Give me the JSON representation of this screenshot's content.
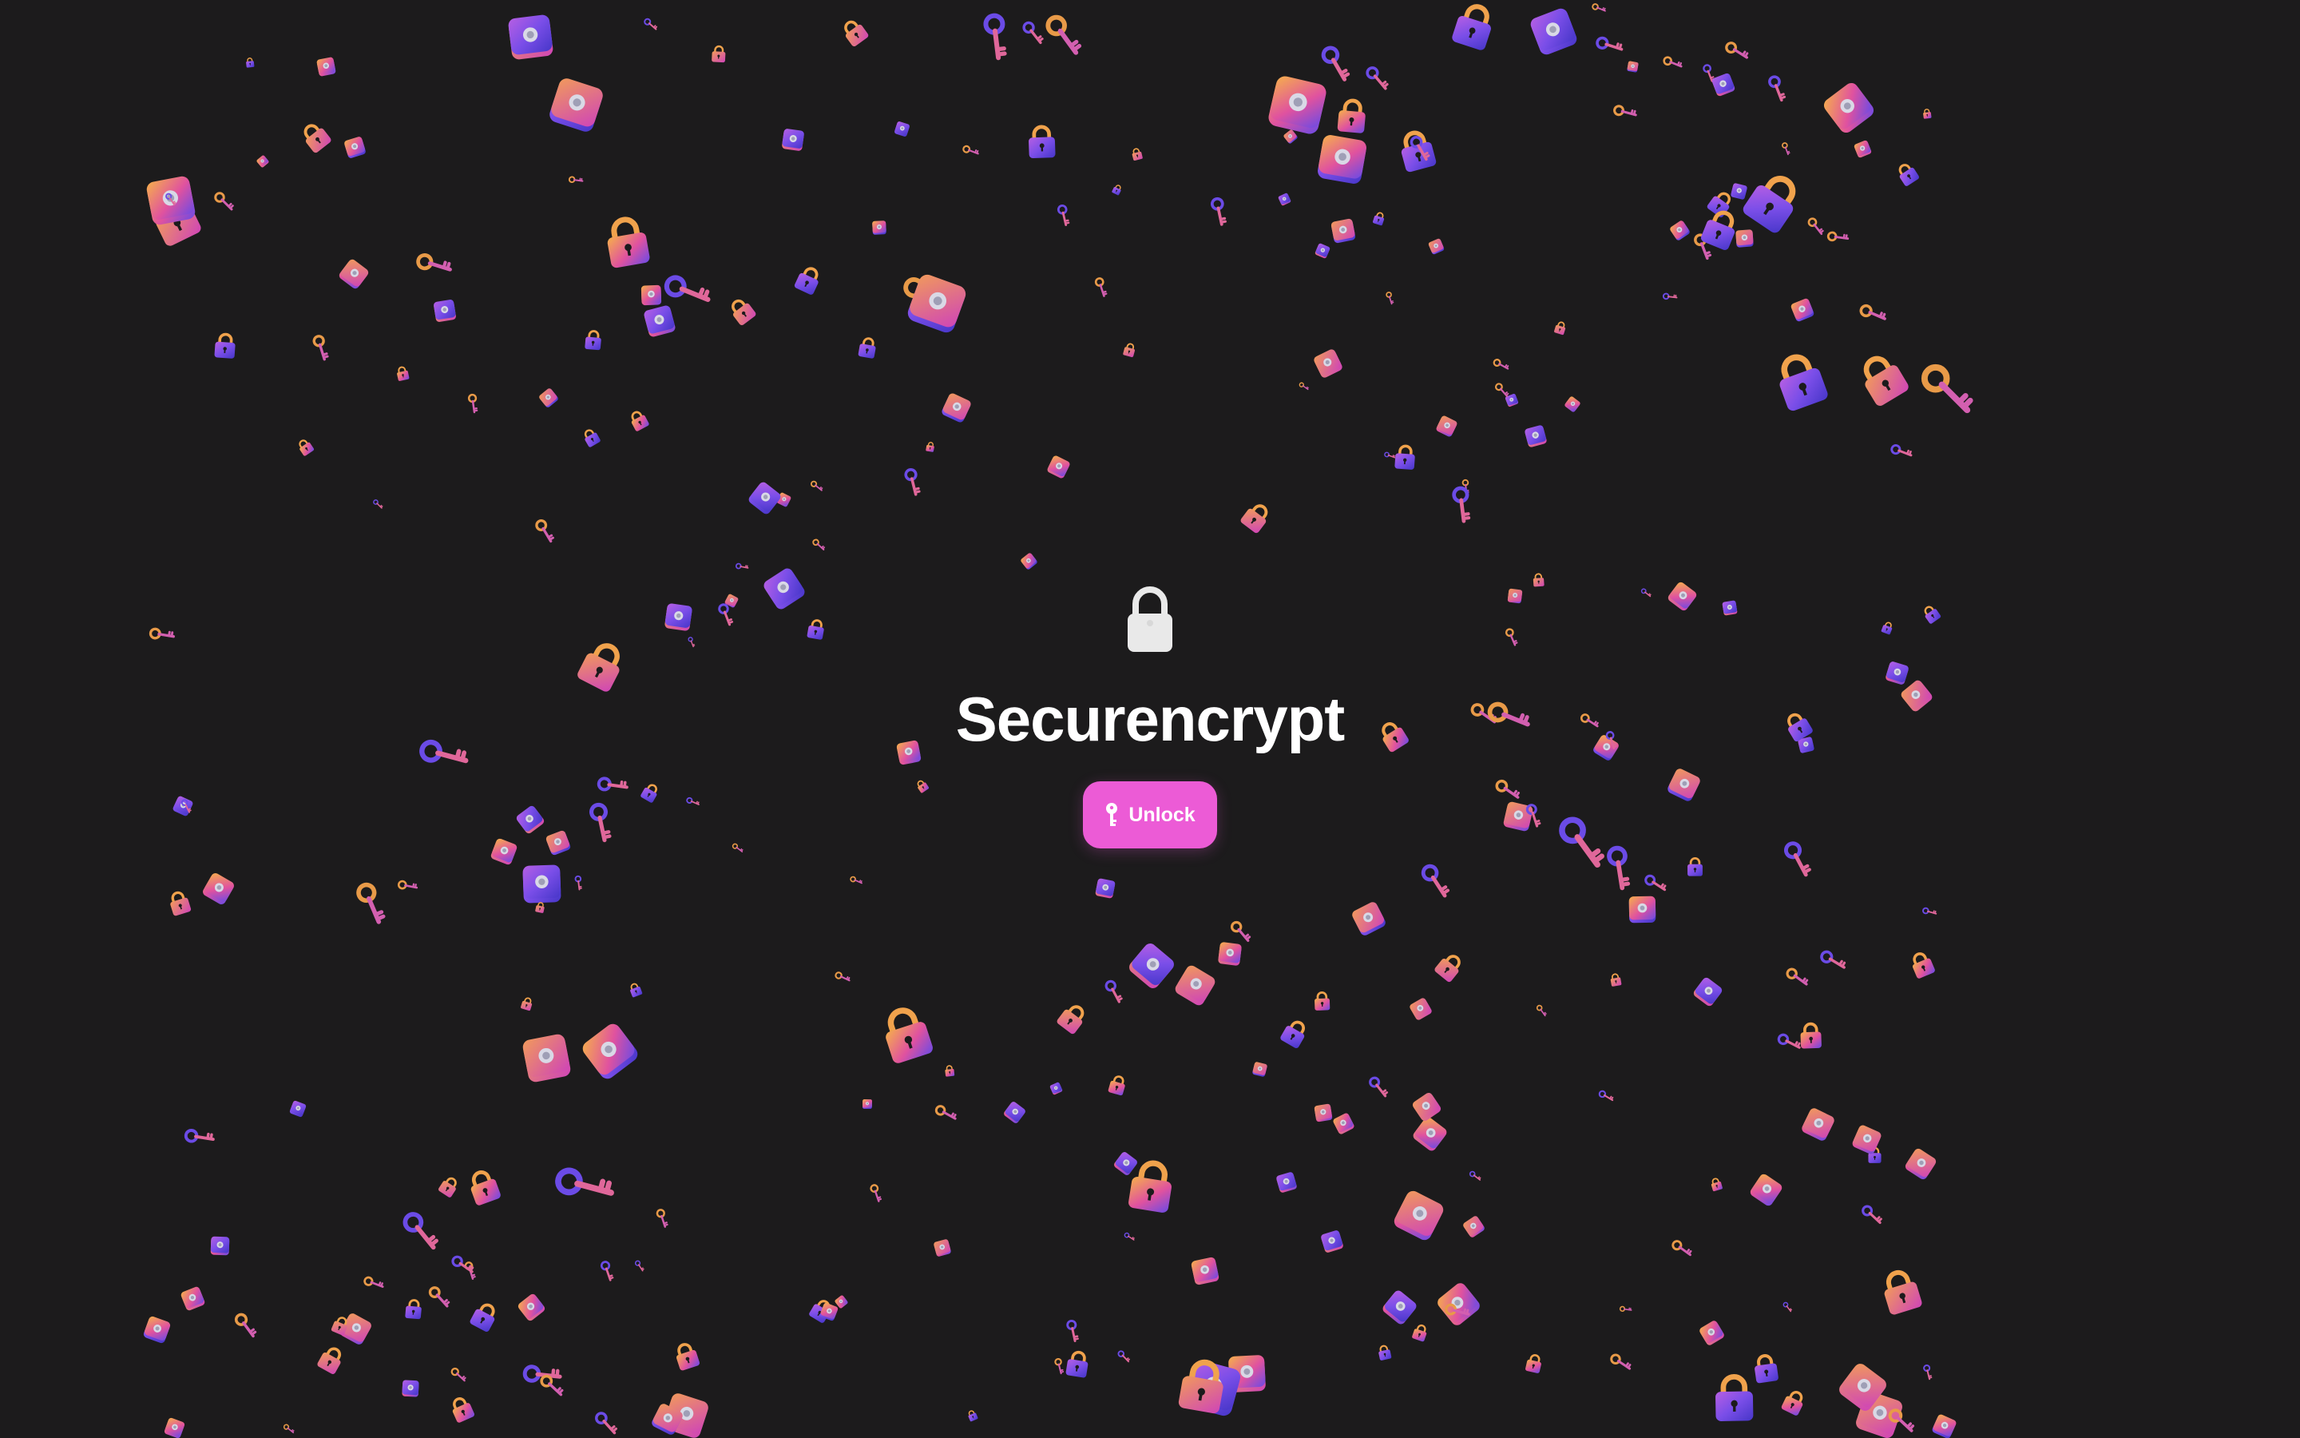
{
  "app": {
    "title": "Securencrypt",
    "hero_icon": "padlock-icon",
    "unlock_button": {
      "label": "Unlock",
      "icon": "key-icon"
    }
  },
  "colors": {
    "background": "#1c1b1c",
    "accent": "#ec5bd6",
    "title": "#ffffff",
    "hero_lock": "#e9e9e9",
    "confetti_gradient": [
      "#f2a444",
      "#dd4fa8",
      "#5b4ae0"
    ]
  },
  "background_decoration": {
    "description_icons": [
      "safe-icon",
      "padlock-icon",
      "key-icon"
    ]
  }
}
